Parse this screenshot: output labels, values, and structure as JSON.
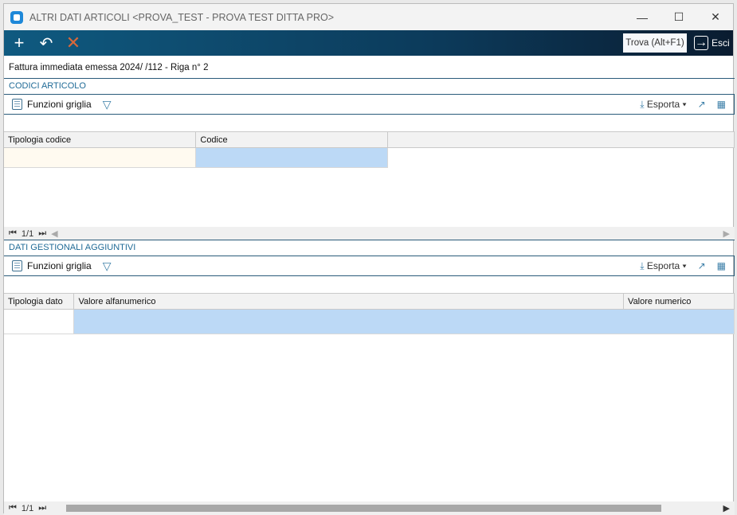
{
  "window": {
    "title": "ALTRI DATI ARTICOLI <PROVA_TEST - PROVA TEST DITTA PRO>"
  },
  "toolbar": {
    "trova": "Trova (Alt+F1)",
    "esci": "Esci"
  },
  "document_line": "Fattura immediata emessa 2024/ /112 - Riga n° 2",
  "panel1": {
    "title": "CODICI ARTICOLO",
    "funzioni": "Funzioni griglia",
    "esporta": "Esporta",
    "columns": [
      "Tipologia codice",
      "Codice"
    ],
    "pager": "1/1"
  },
  "panel2": {
    "title": "DATI GESTIONALI AGGIUNTIVI",
    "funzioni": "Funzioni griglia",
    "esporta": "Esporta",
    "columns": [
      "Tipologia dato",
      "Valore alfanumerico",
      "Valore numerico"
    ],
    "pager": "1/1"
  }
}
